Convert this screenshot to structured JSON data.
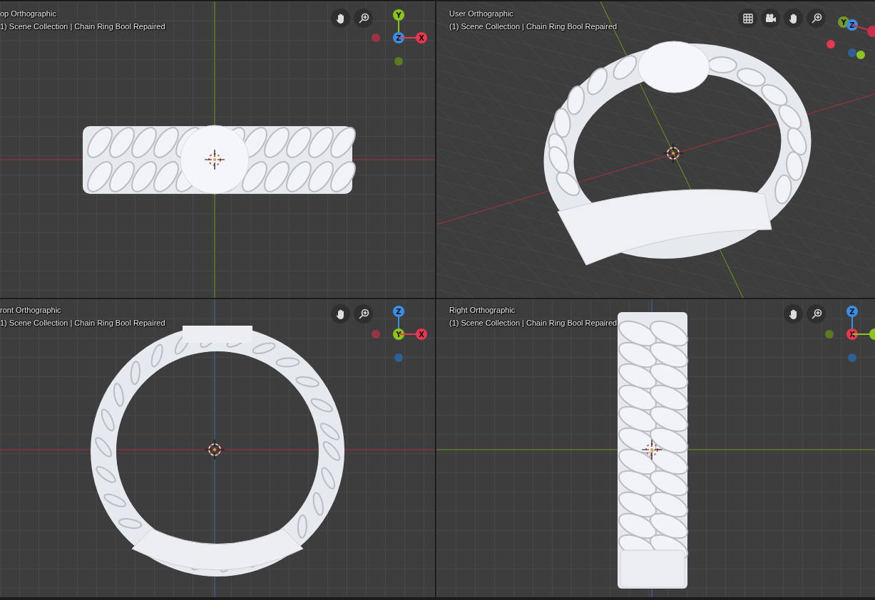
{
  "viewports": [
    {
      "kind": "top",
      "title": "op Orthographic",
      "subtitle": "1) Scene Collection | Chain Ring Bool Repaired",
      "tools": [
        {
          "kind": "hand"
        },
        {
          "kind": "zoom"
        }
      ],
      "gizmo": [
        {
          "kind": "handle",
          "label": "Y",
          "color": "#8bc41f"
        },
        {
          "kind": "handle",
          "label": "Z",
          "color": "#3b8ee6"
        },
        {
          "kind": "handle",
          "label": "X",
          "color": "#e8384f"
        },
        {
          "kind": "dot",
          "color": "#9c3343"
        },
        {
          "kind": "dot",
          "color": "#5b7a22"
        }
      ]
    },
    {
      "kind": "user",
      "title": "User Orthographic",
      "subtitle": "(1) Scene Collection | Chain Ring Bool Repaired",
      "tools": [
        {
          "kind": "grid"
        },
        {
          "kind": "camera"
        },
        {
          "kind": "hand"
        },
        {
          "kind": "zoom"
        }
      ],
      "gizmo": [
        {
          "kind": "handle",
          "label": "Y",
          "color": "#6f9a2a"
        },
        {
          "kind": "handle",
          "label": "Z",
          "color": "#3b8ee6"
        },
        {
          "kind": "handle",
          "color": "#c8304a"
        },
        {
          "kind": "dot",
          "color": "#e8384f"
        },
        {
          "kind": "dot",
          "color": "#2f5f95"
        },
        {
          "kind": "dot",
          "color": "#8bc41f"
        }
      ]
    },
    {
      "kind": "front",
      "title": "ront Orthographic",
      "subtitle": "1) Scene Collection | Chain Ring Bool Repaired",
      "tools": [
        {
          "kind": "hand"
        },
        {
          "kind": "zoom"
        }
      ],
      "gizmo": [
        {
          "kind": "handle",
          "label": "Z",
          "color": "#3b8ee6"
        },
        {
          "kind": "handle",
          "label": "Y",
          "color": "#8bc41f"
        },
        {
          "kind": "handle",
          "label": "X",
          "color": "#e8384f"
        },
        {
          "kind": "dot",
          "color": "#9c3343"
        },
        {
          "kind": "dot",
          "color": "#2f5f95"
        }
      ]
    },
    {
      "kind": "right",
      "title": "Right Orthographic",
      "subtitle": "(1) Scene Collection | Chain Ring Bool Repaired",
      "tools": [
        {
          "kind": "hand"
        },
        {
          "kind": "zoom"
        }
      ],
      "gizmo": [
        {
          "kind": "handle",
          "label": "Z",
          "color": "#3b8ee6"
        },
        {
          "kind": "handle",
          "label": "X",
          "color": "#e8384f"
        },
        {
          "kind": "handle",
          "color": "#8bc41f"
        },
        {
          "kind": "dot",
          "color": "#5b7a22"
        },
        {
          "kind": "dot",
          "color": "#2f5f95"
        }
      ]
    }
  ]
}
